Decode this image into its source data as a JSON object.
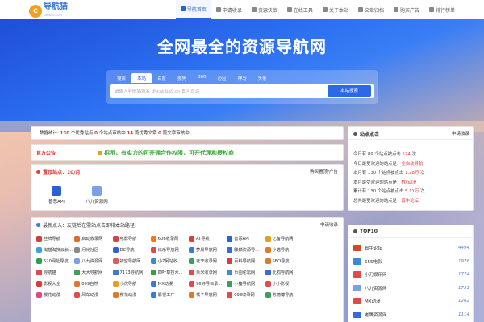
{
  "nav": {
    "logo_text": "导航猫",
    "logo_sub": "DHMAO.COM",
    "menu": [
      {
        "label": "导航首页",
        "active": true
      },
      {
        "label": "申请收录"
      },
      {
        "label": "资源快审"
      },
      {
        "label": "在线工具"
      },
      {
        "label": "关于本站"
      },
      {
        "label": "文章归档"
      },
      {
        "label": "购买广告"
      },
      {
        "label": "排行榜单"
      }
    ]
  },
  "hero": {
    "title": "全网最全的资源导航网"
  },
  "search": {
    "tabs": [
      "搜索",
      "本站",
      "百度",
      "搜狗",
      "360",
      "必应",
      "神马",
      "头条"
    ],
    "active_tab": "本站",
    "placeholder": "请输入导航猫域名 dhcat.ba9.cn 即可直达",
    "button": "本站搜索"
  },
  "stats": {
    "label": "数据统计:",
    "n1": "130",
    "t1": "个优秀站点",
    "n2": "0",
    "t2": "个站点审核中",
    "n3": "14",
    "t3": "篇优秀文章",
    "n4": "0",
    "t4": "篇文章审核中"
  },
  "notice": {
    "tag": "官方公告",
    "text": "招租，有实力的可开通合作权限，可开代理和授权商"
  },
  "fav": {
    "title": "置顶站点：10/月",
    "right": "购买置顶/广告",
    "items": [
      {
        "label": "善恶API",
        "color": "#2a62d6"
      },
      {
        "label": "八九资源网",
        "color": "#7aa0e8"
      }
    ]
  },
  "links": {
    "title": "最新点入：友链后在需站点击即排本站路径!",
    "right": "申请收录",
    "items": [
      {
        "label": "丝牌导航",
        "color": "#d23c3c"
      },
      {
        "label": "启动收录网",
        "color": "#e06a2a"
      },
      {
        "label": "电影导航",
        "color": "#d94242"
      },
      {
        "label": "606收录网",
        "color": "#f07a1a"
      },
      {
        "label": "AT导航",
        "color": "#e03a3a"
      },
      {
        "label": "善恶API",
        "color": "#2a62d6"
      },
      {
        "label": "亿备导航网",
        "color": "#e0a020"
      },
      {
        "label": "",
        "color": "#ffffff"
      },
      {
        "label": "淘猫淘搜云长...",
        "color": "#3aa0e0"
      },
      {
        "label": "月光社区",
        "color": "#888888"
      },
      {
        "label": "DC导航",
        "color": "#2a62d6"
      },
      {
        "label": "炫乐导航网",
        "color": "#e04a4a"
      },
      {
        "label": "梦晨导航网",
        "color": "#3a7ad6"
      },
      {
        "label": "滕麟资源导...",
        "color": "#3a6ad6"
      },
      {
        "label": "小猫导航",
        "color": "#e07a2a"
      },
      {
        "label": "",
        "color": "#ffffff"
      },
      {
        "label": "520网址导航",
        "color": "#2aa050"
      },
      {
        "label": "八九资源网",
        "color": "#7aa0e8"
      },
      {
        "label": "初空导航网",
        "color": "#e05a5a"
      },
      {
        "label": "小Z网站收...",
        "color": "#3a8ad6"
      },
      {
        "label": "老李收录网",
        "color": "#3aa05a"
      },
      {
        "label": "百科导航网",
        "color": "#e03a3a"
      },
      {
        "label": "SEO导航",
        "color": "#e07a2a"
      },
      {
        "label": "",
        "color": "#ffffff"
      },
      {
        "label": "导航猫",
        "color": "#e04a4a"
      },
      {
        "label": "大大导航网",
        "color": "#3aa05a"
      },
      {
        "label": "7173导航网",
        "color": "#3a7ad6"
      },
      {
        "label": "四叶草技术...",
        "color": "#3aa03a"
      },
      {
        "label": "余米收录网",
        "color": "#e04a4a"
      },
      {
        "label": "币圈论坛网",
        "color": "#3a8ad6"
      },
      {
        "label": "北鸥导航网",
        "color": "#3a6ad6"
      },
      {
        "label": "",
        "color": "#ffffff"
      },
      {
        "label": "影视大全",
        "color": "#e03a3a"
      },
      {
        "label": "009自然",
        "color": "#e07a2a"
      },
      {
        "label": "小优导航",
        "color": "#e0a020"
      },
      {
        "label": "MX动漫",
        "color": "#3a7ad6"
      },
      {
        "label": "96好导目录...",
        "color": "#e04a4a"
      },
      {
        "label": "小猪导航网",
        "color": "#3aa05a"
      },
      {
        "label": "小小影视",
        "color": "#e04a4a"
      },
      {
        "label": "",
        "color": "#ffffff"
      },
      {
        "label": "樱花动漫",
        "color": "#e04a7a"
      },
      {
        "label": "风车动漫",
        "color": "#e04a4a"
      },
      {
        "label": "樱花动漫",
        "color": "#e07a2a"
      },
      {
        "label": "影视工厂",
        "color": "#3a7ad6"
      },
      {
        "label": "橘子导航网",
        "color": "#e07a2a"
      },
      {
        "label": "998收录网",
        "color": "#e04a4a"
      },
      {
        "label": "苏德博导航",
        "color": "#3aa05a"
      },
      {
        "label": "",
        "color": "#ffffff"
      }
    ]
  },
  "side": {
    "title": "站点点击",
    "right": "申请收录",
    "lines": [
      {
        "a": "今日有 ",
        "b": "89",
        "c": " 个站点被点击 ",
        "d": "574",
        "e": " 次"
      },
      {
        "a": "今日最受欢迎的站点是：",
        "b": "",
        "c": "",
        "d": "全自动导航",
        "e": ""
      },
      {
        "a": "本月有 130 个站点被点击 ",
        "b": "",
        "c": "",
        "d": "1.28万",
        "e": " 次"
      },
      {
        "a": "本月最受欢迎的站点是：",
        "b": "",
        "c": "",
        "d": "MX动漫",
        "e": ""
      },
      {
        "a": "累计有 130 个站点被点击 ",
        "b": "",
        "c": "",
        "d": "5.11万",
        "e": " 次"
      },
      {
        "a": "总共最受欢迎的站点是：",
        "b": "",
        "c": "",
        "d": "真牛论坛",
        "e": ""
      }
    ]
  },
  "top10": {
    "title": "TOP10",
    "rows": [
      {
        "name": "真牛论坛",
        "num": "4494",
        "color": "#d24a2a"
      },
      {
        "name": "555电影",
        "num": "1976",
        "color": "#3a8ad6"
      },
      {
        "name": "小刀娱乐网",
        "num": "1774",
        "color": "#e04a4a"
      },
      {
        "name": "八九资源网",
        "num": "1731",
        "color": "#7aa0e8"
      },
      {
        "name": "MX动漫",
        "num": "1262",
        "color": "#e04a4a"
      },
      {
        "name": "老鹰资源网",
        "num": "1114",
        "color": "#3a6ad6"
      }
    ]
  }
}
